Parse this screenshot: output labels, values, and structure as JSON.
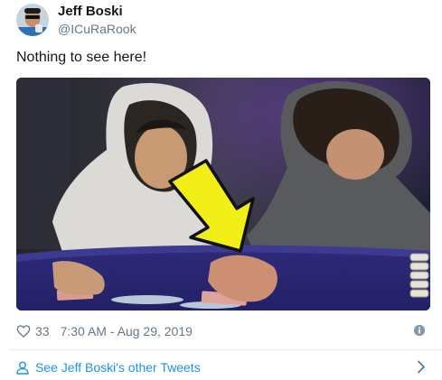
{
  "author": {
    "name": "Jeff Boski",
    "handle": "@ICuRaRook"
  },
  "tweet": {
    "text": "Nothing to see here!",
    "likes": "33",
    "timestamp": "7:30 AM - Aug 29, 2019"
  },
  "footer": {
    "link_label": "See Jeff Boski's other Tweets"
  },
  "colors": {
    "accent": "#1b95e0",
    "muted": "#657786",
    "divider": "#e6ecf0",
    "arrow": "#f2ee18"
  },
  "icons": [
    "avatar",
    "heart-icon",
    "info-icon",
    "person-icon",
    "chevron-right-icon",
    "arrow-annotation"
  ]
}
